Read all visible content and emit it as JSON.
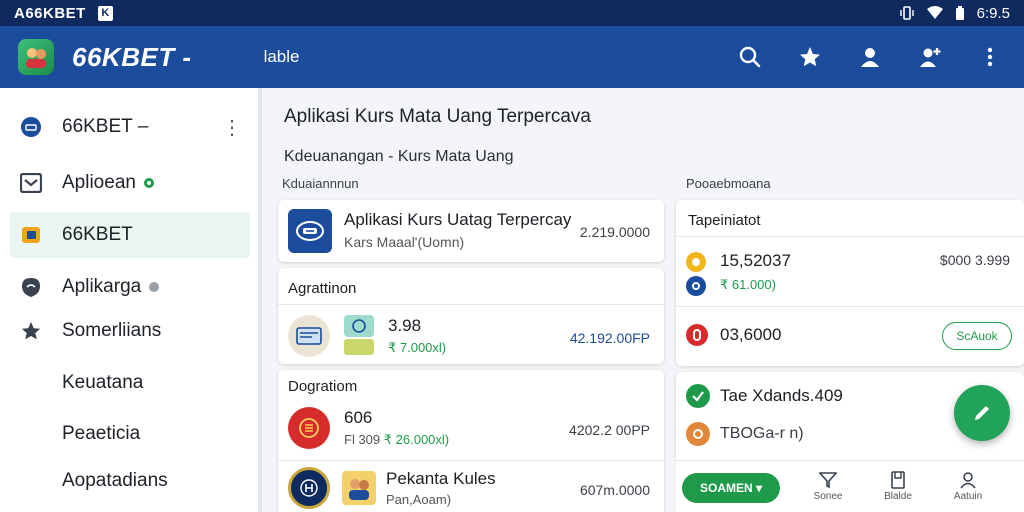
{
  "status_bar": {
    "carrier": "A66KBET",
    "badge": "K",
    "time": "6:9.5"
  },
  "app_bar": {
    "title": "66KBET -",
    "subtitle": "lable"
  },
  "sidebar": {
    "items": [
      {
        "label": "66KBET –"
      },
      {
        "label": "Aplioean"
      },
      {
        "label": "66KBET"
      },
      {
        "label": "Aplikarga"
      },
      {
        "label": "Somerliians"
      },
      {
        "label": "Keuatana"
      },
      {
        "label": "Peaeticia"
      },
      {
        "label": "Aopatadians"
      }
    ]
  },
  "main": {
    "page_title": "Aplikasi Kurs Mata Uang Terpercava",
    "breadcrumb": "Kdeuanangan - Kurs Mata Uang",
    "left_section_label": "Kduaiannnun",
    "right_section_label": "Pooaebmoana",
    "featured": {
      "title": "Aplikasi Kurs Uatag Terpercay",
      "subtitle": "Kars Maaal'(Uomn)",
      "amount": "2.219.0000"
    },
    "list_card_1": {
      "header": "Agrattinon",
      "row": {
        "value": "3.98",
        "sub": "₹ 7.000xl)",
        "amount": "42.192.00FP"
      }
    },
    "list_card_2": {
      "header": "Dogratiom",
      "rows": [
        {
          "value": "606",
          "sub": "Fl 309",
          "sub_green": "₹ 26.000xl)",
          "amount": "4202.2 00PP"
        },
        {
          "value": "Pekanta Kules",
          "sub": "Pan,Aoam)",
          "amount": "607m.0000"
        }
      ]
    },
    "right_card_1": {
      "header": "Tapeiniatot",
      "rows": [
        {
          "value": "15,52037",
          "sub": "₹ 61.000)",
          "amount": "$000 3.999"
        },
        {
          "value": "03,6000",
          "button": "ScAuok"
        }
      ]
    },
    "right_card_2": {
      "rows": [
        {
          "value": "Tae Xdands.409"
        },
        {
          "value": "TBOGa-r n)"
        }
      ]
    },
    "bottom_bar": {
      "primary": "SOAMEN ▾",
      "items": [
        {
          "label": "Sonee"
        },
        {
          "label": "Blalde"
        },
        {
          "label": "Aatuin"
        }
      ]
    }
  },
  "colors": {
    "status_bar": "#0e2a5e",
    "app_bar": "#1c4c9c",
    "accent_green": "#1f9a4a",
    "active_item_bg": "#e9f5ee"
  }
}
